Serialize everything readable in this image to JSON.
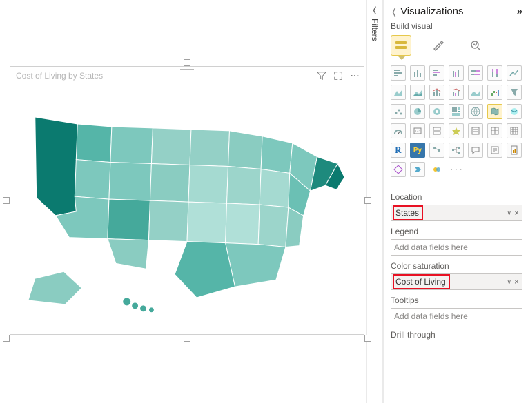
{
  "pane": {
    "title": "Visualizations",
    "subtitle": "Build visual"
  },
  "filters": {
    "label": "Filters"
  },
  "visual": {
    "title": "Cost of Living by States"
  },
  "viz_types": {
    "r_label": "R",
    "py_label": "Py",
    "more": "· · ·"
  },
  "fields": {
    "location": {
      "label": "Location",
      "value": "States"
    },
    "legend": {
      "label": "Legend",
      "placeholder": "Add data fields here"
    },
    "saturation": {
      "label": "Color saturation",
      "value": "Cost of Living"
    },
    "tooltips": {
      "label": "Tooltips",
      "placeholder": "Add data fields here"
    },
    "drill": {
      "label": "Drill through"
    }
  }
}
